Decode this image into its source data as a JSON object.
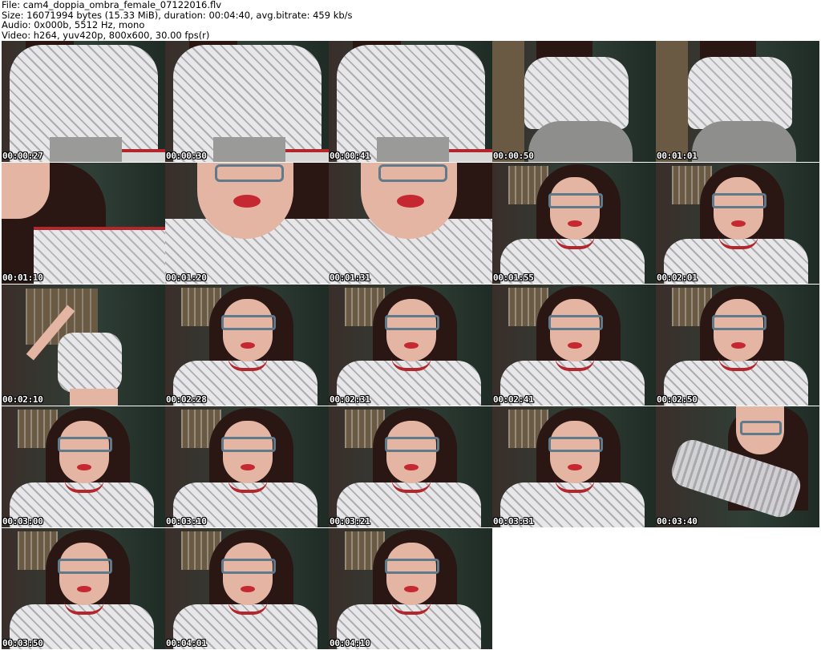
{
  "header": {
    "file": "File: cam4_doppia_ombra_female_07122016.flv",
    "size": "Size: 16071994 bytes (15.33 MiB), duration: 00:04:40, avg.bitrate: 459 kb/s",
    "audio": "Audio: 0x000b, 5512 Hz, mono",
    "video": "Video: h264, yuv420p, 800x600, 30.00 fps(r)"
  },
  "thumbnails": [
    {
      "timestamp": "00:00:27",
      "scene": "torso-close"
    },
    {
      "timestamp": "00:00:30",
      "scene": "torso-close"
    },
    {
      "timestamp": "00:00:41",
      "scene": "torso-close"
    },
    {
      "timestamp": "00:00:50",
      "scene": "seated-back"
    },
    {
      "timestamp": "00:01:01",
      "scene": "seated-back"
    },
    {
      "timestamp": "00:01:10",
      "scene": "hair-close"
    },
    {
      "timestamp": "00:01:20",
      "scene": "face-close"
    },
    {
      "timestamp": "00:01:31",
      "scene": "face-close"
    },
    {
      "timestamp": "00:01:55",
      "scene": "portrait"
    },
    {
      "timestamp": "00:02:01",
      "scene": "portrait"
    },
    {
      "timestamp": "00:02:10",
      "scene": "stretch"
    },
    {
      "timestamp": "00:02:28",
      "scene": "portrait"
    },
    {
      "timestamp": "00:02:31",
      "scene": "portrait"
    },
    {
      "timestamp": "00:02:41",
      "scene": "portrait"
    },
    {
      "timestamp": "00:02:50",
      "scene": "portrait"
    },
    {
      "timestamp": "00:03:00",
      "scene": "portrait"
    },
    {
      "timestamp": "00:03:10",
      "scene": "portrait"
    },
    {
      "timestamp": "00:03:21",
      "scene": "portrait"
    },
    {
      "timestamp": "00:03:31",
      "scene": "portrait"
    },
    {
      "timestamp": "00:03:40",
      "scene": "arm-motion"
    },
    {
      "timestamp": "00:03:50",
      "scene": "portrait"
    },
    {
      "timestamp": "00:04:01",
      "scene": "portrait"
    },
    {
      "timestamp": "00:04:10",
      "scene": "portrait"
    }
  ],
  "colors": {
    "wall": "#2f3f36",
    "shirt": "#e7e7ea",
    "hair": "#2a1714",
    "skin": "#e4b5a3",
    "glasses": "#5f7a8a",
    "lips": "#c62831",
    "trim": "#b3262b",
    "shelf": "#6a5a44"
  }
}
